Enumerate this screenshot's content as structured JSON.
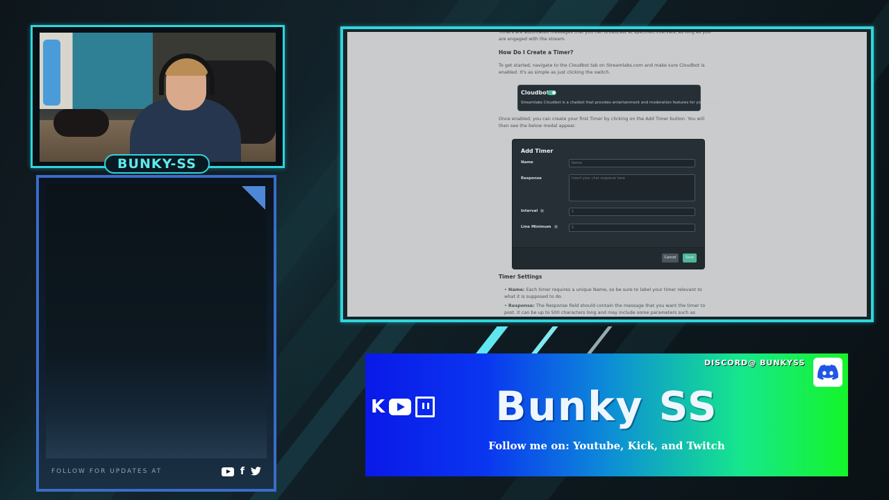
{
  "streamer": {
    "name_tag": "BUNKY-SS"
  },
  "panel": {
    "follow_text": "FOLLOW FOR UPDATES AT",
    "social_icons": [
      "youtube-icon",
      "facebook-icon",
      "twitter-icon"
    ]
  },
  "screen": {
    "intro_text": "Timers are automated messages that you can broadcast at specified intervals, as long as you are engaged with the stream.",
    "heading_create": "How Do I Create a Timer?",
    "para1": "To get started, navigate to the Cloudbot tab on Streamlabs.com and make sure Cloudbot is enabled. It's as simple as just clicking the switch.",
    "cloudbot_card": {
      "title": "Cloudbot",
      "description": "Streamlabs Cloudbot is a chatbot that provides entertainment and moderation features for your stream."
    },
    "para2": "Once enabled, you can create your first Timer by clicking on the Add Timer button. You will then see the below modal appear.",
    "modal": {
      "title": "Add Timer",
      "name_label": "Name",
      "name_placeholder": "Name",
      "response_label": "Response",
      "response_placeholder": "Insert your chat response here",
      "interval_label": "Interval",
      "interval_value": "5",
      "line_min_label": "Line Minimum",
      "line_min_value": "5",
      "cancel_label": "Cancel",
      "save_label": "Save"
    },
    "heading_settings": "Timer Settings",
    "bullet1_label": "Name:",
    "bullet1_text": "Each timer requires a unique Name, so be sure to label your timer relevant to what it is supposed to do.",
    "bullet2_label": "Response:",
    "bullet2_text": "The Response field should contain the message that you want the timer to post. It can be up to 500 characters long and may include some parameters such as {readapi url_here}, {channel.recent_tweet}, {uptime}, {channel.game}, {channel.title} and more."
  },
  "banner": {
    "title": "Bunky SS",
    "subtitle": "Follow me on: Youtube, Kick, and Twitch",
    "discord_text": "DISCORD@ BUNKYSS",
    "colors": {
      "start": "#0a19e8",
      "end": "#15f52a"
    }
  },
  "colors": {
    "accent_cyan": "#2fd5de",
    "panel_blue": "#3a6dc8"
  }
}
